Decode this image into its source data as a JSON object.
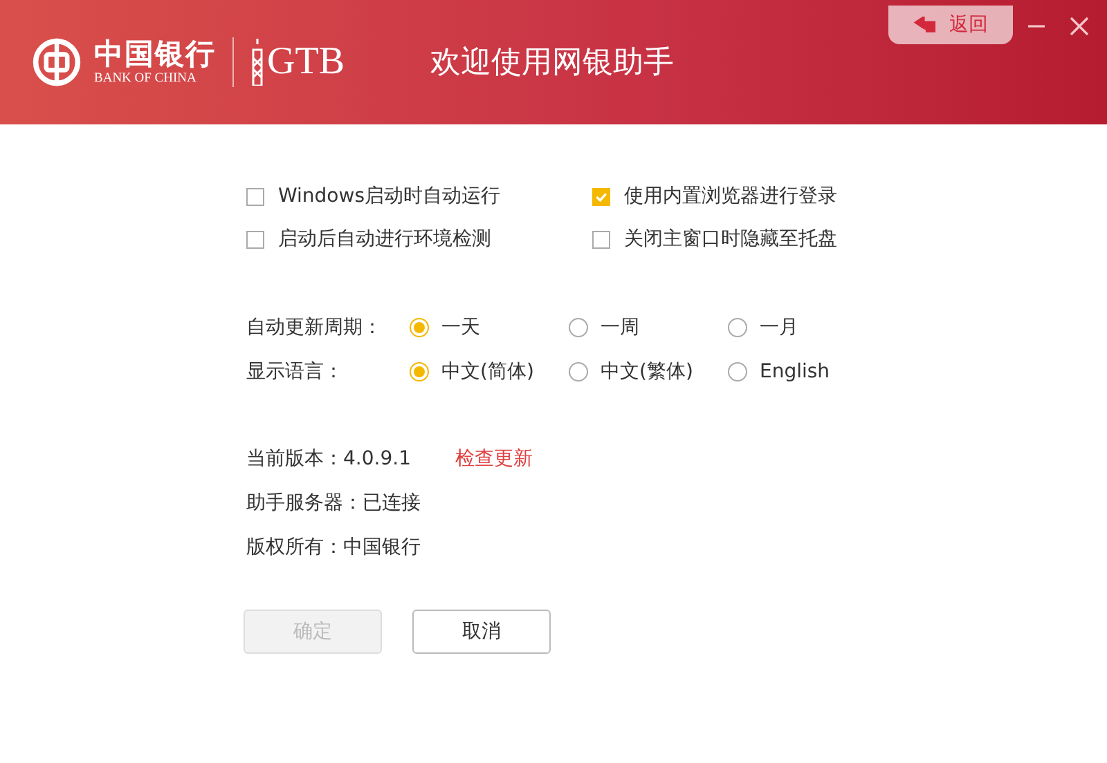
{
  "header": {
    "logo_cn": "中国银行",
    "logo_en": "BANK OF CHINA",
    "logo_gtb": "GTB",
    "title": "欢迎使用网银助手",
    "back_button": "返回"
  },
  "checkboxes": [
    {
      "label": "Windows启动时自动运行",
      "checked": false
    },
    {
      "label": "使用内置浏览器进行登录",
      "checked": true
    },
    {
      "label": "启动后自动进行环境检测",
      "checked": false
    },
    {
      "label": "关闭主窗口时隐藏至托盘",
      "checked": false
    }
  ],
  "radio_groups": [
    {
      "label": "自动更新周期：",
      "options": [
        {
          "label": "一天",
          "selected": true
        },
        {
          "label": "一周",
          "selected": false
        },
        {
          "label": "一月",
          "selected": false
        }
      ]
    },
    {
      "label": "显示语言：",
      "options": [
        {
          "label": "中文(简体)",
          "selected": true
        },
        {
          "label": "中文(繁体)",
          "selected": false
        },
        {
          "label": "English",
          "selected": false
        }
      ]
    }
  ],
  "info": [
    {
      "text": "当前版本：4.0.9.1",
      "link": "检查更新"
    },
    {
      "text": "助手服务器：已连接"
    },
    {
      "text": "版权所有：中国银行"
    }
  ],
  "buttons": [
    {
      "label": "确定",
      "disabled": true
    },
    {
      "label": "取消",
      "disabled": false
    }
  ]
}
